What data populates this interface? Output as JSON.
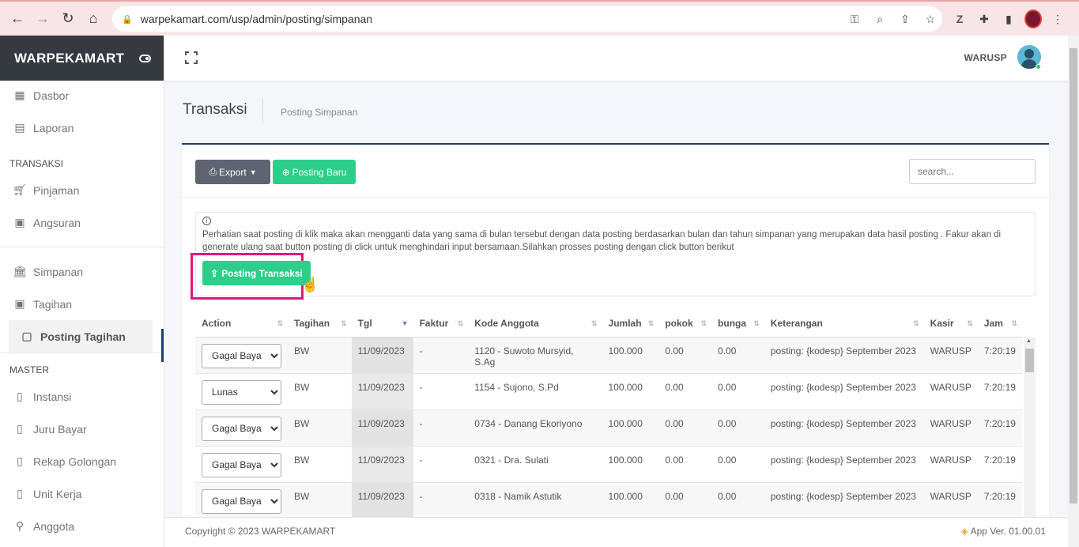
{
  "browser": {
    "url": "warpekamart.com/usp/admin/posting/simpanan"
  },
  "brand": {
    "name": "WARPEKAMART"
  },
  "sidebar": {
    "items_top": [
      {
        "label": "Dasbor",
        "icon": "dashboard-icon"
      },
      {
        "label": "Laporan",
        "icon": "report-icon"
      }
    ],
    "section_transaksi": "TRANSAKSI",
    "items_transaksi": [
      {
        "label": "Pinjaman",
        "icon": "cart-icon"
      },
      {
        "label": "Angsuran",
        "icon": "money-icon"
      }
    ],
    "items_simpanan": [
      {
        "label": "Simpanan",
        "icon": "bank-icon"
      },
      {
        "label": "Tagihan",
        "icon": "money-icon"
      },
      {
        "label": "Posting Tagihan",
        "icon": "note-icon"
      }
    ],
    "section_master": "MASTER",
    "items_master": [
      {
        "label": "Instansi",
        "icon": "book-icon"
      },
      {
        "label": "Juru Bayar",
        "icon": "book-icon"
      },
      {
        "label": "Rekap Golongan",
        "icon": "book-icon"
      },
      {
        "label": "Unit Kerja",
        "icon": "book-icon"
      },
      {
        "label": "Anggota",
        "icon": "search-icon"
      }
    ]
  },
  "header": {
    "user_name": "WARUSP"
  },
  "page": {
    "title": "Transaksi",
    "breadcrumb": "Posting Simpanan"
  },
  "toolbar": {
    "export_label": "Export",
    "new_label": "Posting Baru",
    "search_placeholder": "search..."
  },
  "notice": {
    "text": "Perhatian saat posting di klik maka akan mengganti data yang sama di bulan tersebut dengan data posting berdasarkan bulan dan tahun simpanan yang merupakan data hasil posting . Fakur akan di generate ulang saat button posting di click untuk menghindari input bersamaan.Silahkan prosses posting dengan click button berikut",
    "button_label": "Posting Transaksi"
  },
  "table": {
    "columns": [
      "Action",
      "Tagihan",
      "Tgl",
      "Faktur",
      "Kode Anggota",
      "Jumlah",
      "pokok",
      "bunga",
      "Keterangan",
      "Kasir",
      "Jam"
    ],
    "rows": [
      {
        "action": "Gagal Baya",
        "tagihan": "BW",
        "tgl": "11/09/2023",
        "faktur": "-",
        "kode": "1120 - Suwoto Mursyid, S.Ag",
        "jumlah": "100.000",
        "pokok": "0.00",
        "bunga": "0.00",
        "ket": "posting: {kodesp} September 2023",
        "kasir": "WARUSP",
        "jam": "7:20:19"
      },
      {
        "action": "Lunas",
        "tagihan": "BW",
        "tgl": "11/09/2023",
        "faktur": "-",
        "kode": "1154 - Sujono, S.Pd",
        "jumlah": "100.000",
        "pokok": "0.00",
        "bunga": "0.00",
        "ket": "posting: {kodesp} September 2023",
        "kasir": "WARUSP",
        "jam": "7:20:19"
      },
      {
        "action": "Gagal Baya",
        "tagihan": "BW",
        "tgl": "11/09/2023",
        "faktur": "-",
        "kode": "0734 - Danang Ekoriyono",
        "jumlah": "100.000",
        "pokok": "0.00",
        "bunga": "0.00",
        "ket": "posting: {kodesp} September 2023",
        "kasir": "WARUSP",
        "jam": "7:20:19"
      },
      {
        "action": "Gagal Baya",
        "tagihan": "BW",
        "tgl": "11/09/2023",
        "faktur": "-",
        "kode": "0321 - Dra. Sulati",
        "jumlah": "100.000",
        "pokok": "0.00",
        "bunga": "0.00",
        "ket": "posting: {kodesp} September 2023",
        "kasir": "WARUSP",
        "jam": "7:20:19"
      },
      {
        "action": "Gagal Baya",
        "tagihan": "BW",
        "tgl": "11/09/2023",
        "faktur": "-",
        "kode": "0318 - Namik Astutik",
        "jumlah": "100.000",
        "pokok": "0.00",
        "bunga": "0.00",
        "ket": "posting: {kodesp} September 2023",
        "kasir": "WARUSP",
        "jam": "7:20:19"
      }
    ],
    "action_options": [
      "Gagal Baya",
      "Lunas"
    ]
  },
  "footer": {
    "copyright": "Copyright © 2023 WARPEKAMART",
    "version": "App Ver. 01.00.01"
  },
  "colors": {
    "accent_green": "#2dce89",
    "brand_dark": "#343a40",
    "highlight": "#e0167b",
    "card_border": "#1f3f7a"
  }
}
